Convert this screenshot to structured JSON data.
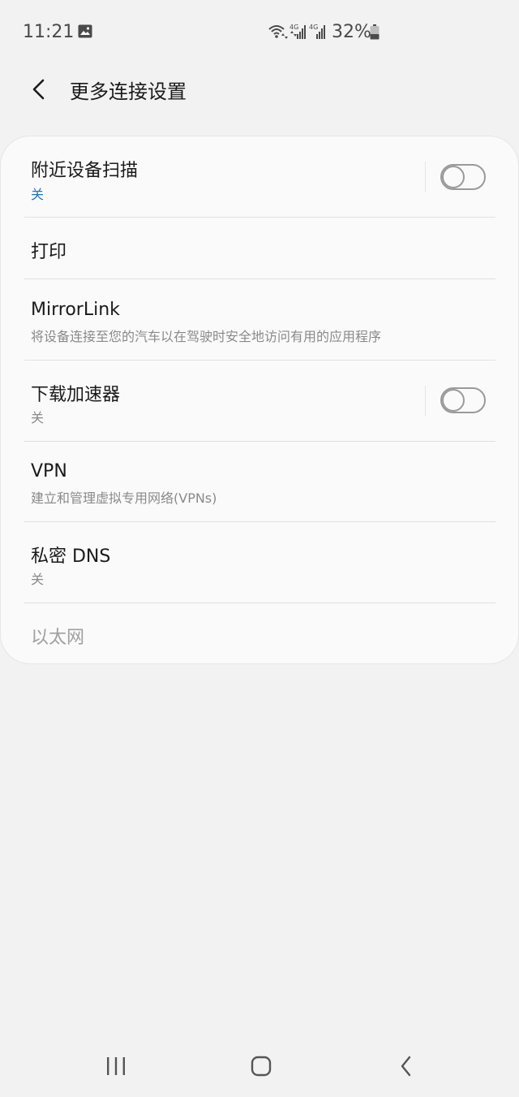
{
  "status_bar": {
    "time": "11:21",
    "battery_percent": "32%",
    "network_label": "4G",
    "icons": [
      "gallery-icon",
      "wifi-icon",
      "signal-4g-sim1-icon",
      "signal-4g-sim2-icon",
      "battery-icon"
    ]
  },
  "header": {
    "back_icon": "chevron-left-icon",
    "title": "更多连接设置"
  },
  "settings": {
    "items": [
      {
        "title": "附近设备扫描",
        "subtitle": "关",
        "subtitle_color": "#1f72c9",
        "has_toggle": true,
        "toggle_on": false
      },
      {
        "title": "打印",
        "subtitle": "",
        "has_toggle": false
      },
      {
        "title": "MirrorLink",
        "subtitle": "将设备连接至您的汽车以在驾驶时安全地访问有用的应用程序",
        "has_toggle": false
      },
      {
        "title": "下载加速器",
        "subtitle": "关",
        "has_toggle": true,
        "toggle_on": false
      },
      {
        "title": "VPN",
        "subtitle": "建立和管理虚拟专用网络(VPNs)",
        "has_toggle": false
      },
      {
        "title": "私密 DNS",
        "subtitle": "关",
        "has_toggle": false
      },
      {
        "title": "以太网",
        "subtitle": "",
        "has_toggle": false,
        "disabled": true
      }
    ]
  },
  "nav_bar": {
    "buttons": [
      "recent-apps-icon",
      "home-icon",
      "back-icon"
    ]
  },
  "colors": {
    "background": "#f2f2f2",
    "card": "#fafafa",
    "accent": "#1f72c9",
    "secondary_text": "#8a8a8a",
    "disabled_text": "#a0a0a0"
  }
}
